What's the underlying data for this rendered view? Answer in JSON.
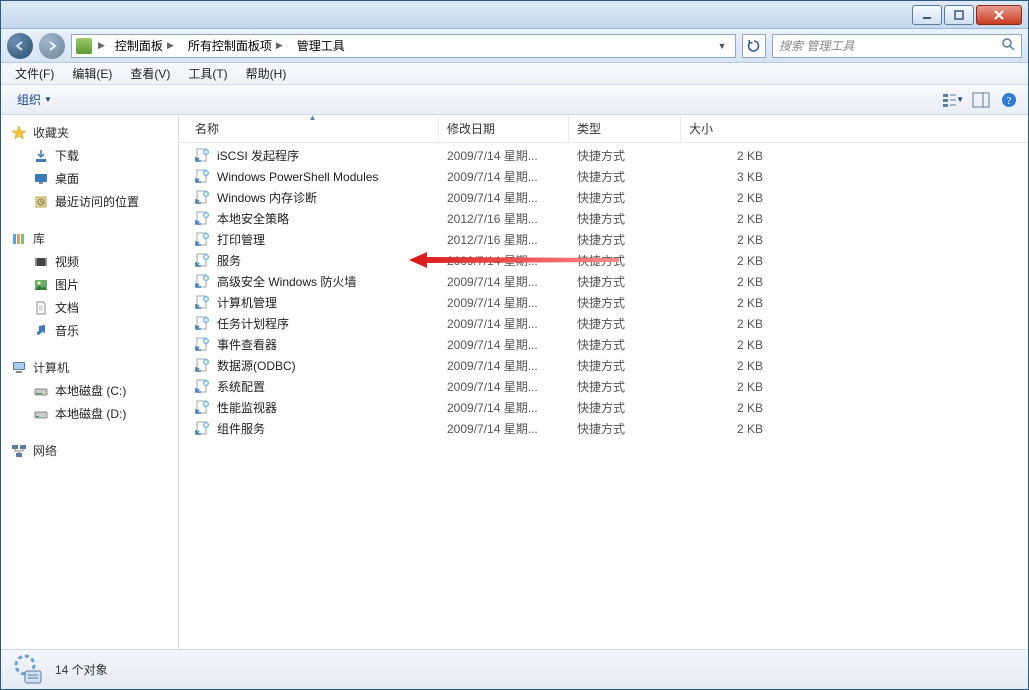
{
  "window": {
    "minimize_tip": "Minimize",
    "maximize_tip": "Maximize",
    "close_tip": "Close"
  },
  "breadcrumbs": [
    "控制面板",
    "所有控制面板项",
    "管理工具"
  ],
  "search": {
    "placeholder": "搜索 管理工具"
  },
  "menu": {
    "file": "文件(F)",
    "edit": "编辑(E)",
    "view": "查看(V)",
    "tools": "工具(T)",
    "help": "帮助(H)"
  },
  "toolbar": {
    "organize": "组织"
  },
  "sidebar": {
    "favorites": {
      "label": "收藏夹",
      "items": [
        "下载",
        "桌面",
        "最近访问的位置"
      ]
    },
    "libraries": {
      "label": "库",
      "items": [
        "视频",
        "图片",
        "文档",
        "音乐"
      ]
    },
    "computer": {
      "label": "计算机",
      "items": [
        "本地磁盘 (C:)",
        "本地磁盘 (D:)"
      ]
    },
    "network": {
      "label": "网络"
    }
  },
  "columns": {
    "name": "名称",
    "date": "修改日期",
    "type": "类型",
    "size": "大小"
  },
  "rows": [
    {
      "name": "iSCSI 发起程序",
      "date": "2009/7/14 星期...",
      "type": "快捷方式",
      "size": "2 KB"
    },
    {
      "name": "Windows PowerShell Modules",
      "date": "2009/7/14 星期...",
      "type": "快捷方式",
      "size": "3 KB"
    },
    {
      "name": "Windows 内存诊断",
      "date": "2009/7/14 星期...",
      "type": "快捷方式",
      "size": "2 KB"
    },
    {
      "name": "本地安全策略",
      "date": "2012/7/16 星期...",
      "type": "快捷方式",
      "size": "2 KB"
    },
    {
      "name": "打印管理",
      "date": "2012/7/16 星期...",
      "type": "快捷方式",
      "size": "2 KB"
    },
    {
      "name": "服务",
      "date": "2009/7/14 星期...",
      "type": "快捷方式",
      "size": "2 KB"
    },
    {
      "name": "高级安全 Windows 防火墙",
      "date": "2009/7/14 星期...",
      "type": "快捷方式",
      "size": "2 KB"
    },
    {
      "name": "计算机管理",
      "date": "2009/7/14 星期...",
      "type": "快捷方式",
      "size": "2 KB"
    },
    {
      "name": "任务计划程序",
      "date": "2009/7/14 星期...",
      "type": "快捷方式",
      "size": "2 KB"
    },
    {
      "name": "事件查看器",
      "date": "2009/7/14 星期...",
      "type": "快捷方式",
      "size": "2 KB"
    },
    {
      "name": "数据源(ODBC)",
      "date": "2009/7/14 星期...",
      "type": "快捷方式",
      "size": "2 KB"
    },
    {
      "name": "系统配置",
      "date": "2009/7/14 星期...",
      "type": "快捷方式",
      "size": "2 KB"
    },
    {
      "name": "性能监视器",
      "date": "2009/7/14 星期...",
      "type": "快捷方式",
      "size": "2 KB"
    },
    {
      "name": "组件服务",
      "date": "2009/7/14 星期...",
      "type": "快捷方式",
      "size": "2 KB"
    }
  ],
  "status": {
    "count_text": "14 个对象"
  },
  "annotation": {
    "target_row_index": 5
  }
}
